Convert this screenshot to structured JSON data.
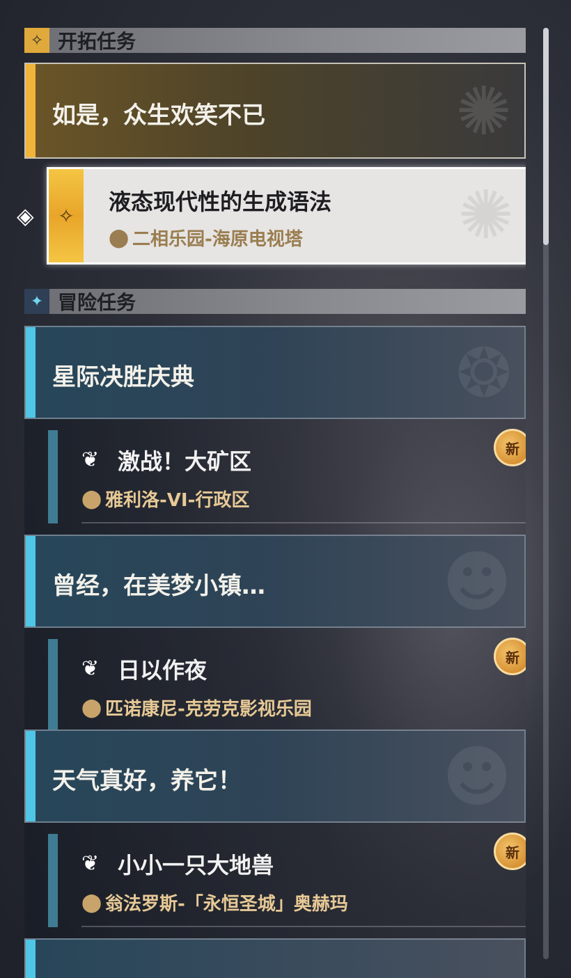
{
  "trailblaze": {
    "header": "开拓任务",
    "icon": "trailblaze-diamond-icon",
    "mission_title": "如是，众生欢笑不已",
    "selected_quest": {
      "title": "液态现代性的生成语法",
      "location": "二相乐园-海原电视塔"
    }
  },
  "adventure": {
    "header": "冒险任务",
    "icon": "adventure-star-icon",
    "missions": [
      {
        "title": "星际决胜庆典",
        "quest": {
          "title": "激战！大矿区",
          "location": "雅利洛-VI-行政区",
          "badge": "新"
        }
      },
      {
        "title": "曾经，在美梦小镇…",
        "quest": {
          "title": "日以作夜",
          "location": "匹诺康尼-克劳克影视乐园",
          "badge": "新"
        }
      },
      {
        "title": "天气真好，养它！",
        "quest": {
          "title": "小小一只大地兽",
          "location": "翁法罗斯-「永恒圣城」奥赫玛",
          "badge": "新"
        }
      }
    ]
  },
  "colors": {
    "trailblaze_accent": "#f0b43a",
    "adventure_accent": "#4fc6e6",
    "location_text": "#e7c996"
  }
}
